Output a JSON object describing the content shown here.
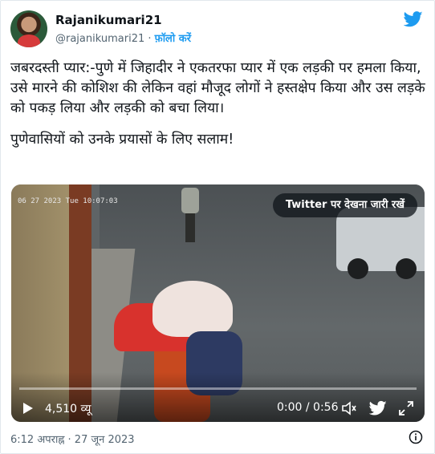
{
  "author": {
    "name": "Rajanikumari21",
    "handle": "@rajanikumari21",
    "separator": "·",
    "follow_label": "फ़ॉलो करें"
  },
  "tweet": {
    "lines": [
      "जबरदस्ती प्यार:-पुणे में  जिहादीर ने एकतरफा प्यार में एक लड़की पर हमला किया,",
      " उसे मारने की कोशिश की लेकिन वहां मौजूद लोगों ने हस्तक्षेप किया और उस लड़के को पकड़ लिया और लड़की को बचा लिया।",
      "पुणेवासियों को उनके प्रयासों के लिए सलाम!"
    ]
  },
  "video": {
    "banner": "Twitter पर देखना जारी रखें",
    "cam_stamp": "06 27 2023  Tue 10:07:03",
    "views": "4,510 व्यू",
    "time": "0:00 / 0:56",
    "progress": 0.0
  },
  "footer": {
    "timestamp": "6:12 अपराह्न · 27 जून 2023"
  },
  "icons": {
    "twitter": "twitter-bird-icon",
    "play": "play-icon",
    "volume": "volume-icon",
    "fullscreen": "fullscreen-icon",
    "info": "info-icon"
  },
  "colors": {
    "accent": "#1d9bf0",
    "text": "#0f1419",
    "muted": "#536471"
  }
}
